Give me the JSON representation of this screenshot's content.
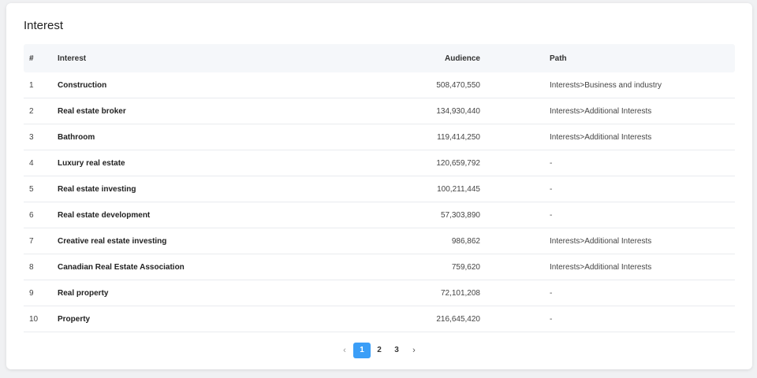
{
  "title": "Interest",
  "columns": {
    "index": "#",
    "interest": "Interest",
    "audience": "Audience",
    "path": "Path"
  },
  "rows": [
    {
      "index": "1",
      "interest": "Construction",
      "audience": "508,470,550",
      "path": "Interests>Business and industry"
    },
    {
      "index": "2",
      "interest": "Real estate broker",
      "audience": "134,930,440",
      "path": "Interests>Additional Interests"
    },
    {
      "index": "3",
      "interest": "Bathroom",
      "audience": "119,414,250",
      "path": "Interests>Additional Interests"
    },
    {
      "index": "4",
      "interest": "Luxury real estate",
      "audience": "120,659,792",
      "path": "-"
    },
    {
      "index": "5",
      "interest": "Real estate investing",
      "audience": "100,211,445",
      "path": "-"
    },
    {
      "index": "6",
      "interest": "Real estate development",
      "audience": "57,303,890",
      "path": "-"
    },
    {
      "index": "7",
      "interest": "Creative real estate investing",
      "audience": "986,862",
      "path": "Interests>Additional Interests"
    },
    {
      "index": "8",
      "interest": "Canadian Real Estate Association",
      "audience": "759,620",
      "path": "Interests>Additional Interests"
    },
    {
      "index": "9",
      "interest": "Real property",
      "audience": "72,101,208",
      "path": "-"
    },
    {
      "index": "10",
      "interest": "Property",
      "audience": "216,645,420",
      "path": "-"
    }
  ],
  "pagination": {
    "prev_icon": "chevron-left-icon",
    "next_icon": "chevron-right-icon",
    "pages": [
      "1",
      "2",
      "3"
    ],
    "current": "1",
    "prev_glyph": "‹",
    "next_glyph": "›"
  },
  "colors": {
    "accent": "#3b9ef7"
  }
}
